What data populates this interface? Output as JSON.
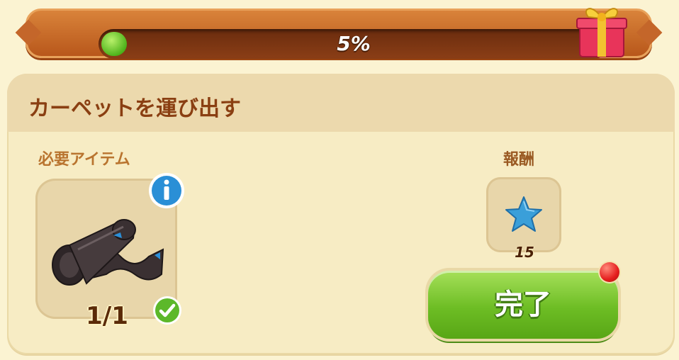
{
  "progress": {
    "percent_label": "5%",
    "fraction": 0.05,
    "fill_color": "#4fb31c"
  },
  "gift_icon": "gift-box-icon",
  "quest": {
    "title": "カーペットを運び出す"
  },
  "required": {
    "label": "必要アイテム",
    "item_icon": "carpet-roll-icon",
    "count": "1/1",
    "status_icon": "check-icon",
    "info_icon": "info-icon"
  },
  "reward": {
    "label": "報酬",
    "icon": "blue-star-icon",
    "amount": "15"
  },
  "complete_button": {
    "label": "完了",
    "color": "#6dbd24",
    "badge_color": "#e51e1e"
  }
}
